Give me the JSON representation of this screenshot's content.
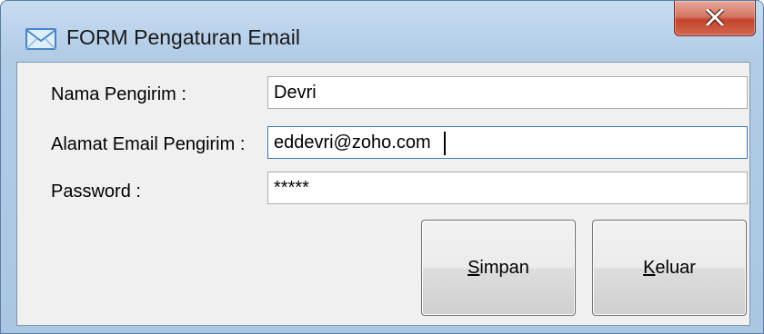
{
  "window": {
    "title": "FORM Pengaturan Email",
    "icon": "envelope-icon",
    "close_glyph": "close-icon"
  },
  "form": {
    "sender_name_label": "Nama Pengirim :",
    "sender_name_value": "Devri",
    "sender_email_label": "Alamat Email Pengirim :",
    "sender_email_value": "eddevri@zoho.com",
    "password_label": "Password :",
    "password_value": "*****"
  },
  "buttons": {
    "save": {
      "accel": "S",
      "rest": "impan"
    },
    "exit": {
      "accel": "K",
      "rest": "eluar"
    }
  },
  "colors": {
    "frame": "#b9d1ea",
    "client": "#f0f0f0",
    "close_button": "#c4442c"
  }
}
